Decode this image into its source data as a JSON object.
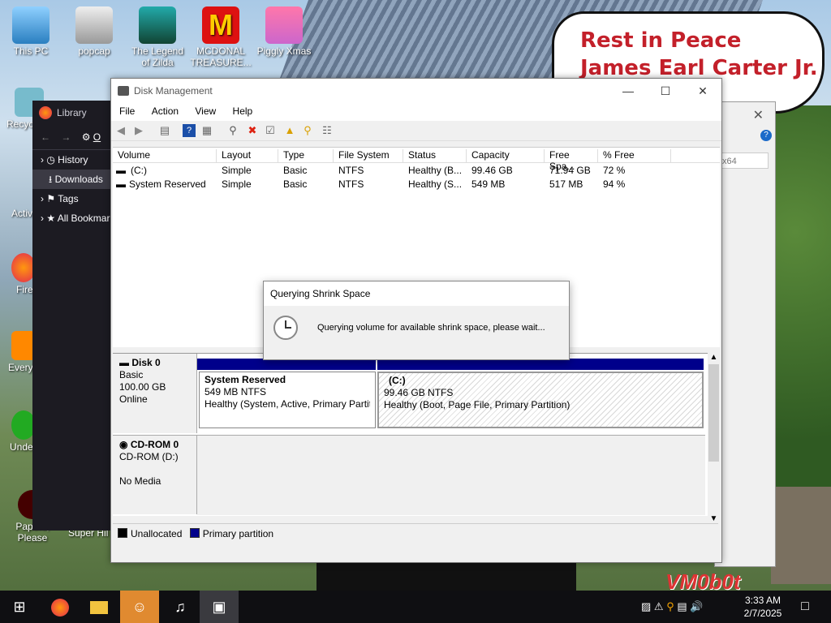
{
  "desktop": {
    "icons": [
      {
        "label": "This PC"
      },
      {
        "label": "popcap"
      },
      {
        "label": "The Legend of Zilda"
      },
      {
        "label": "MCDONAL TREASURE..."
      },
      {
        "label": "Piggly Xmas"
      },
      {
        "label": "Recyc"
      },
      {
        "label": "Activ"
      },
      {
        "label": "Fire"
      },
      {
        "label": "Every"
      },
      {
        "label": "Unde"
      },
      {
        "label": "Papers, Please"
      },
      {
        "label": "Super Hil"
      }
    ],
    "speech_line1": "Rest in Peace",
    "speech_line2": "James Earl Carter Jr.",
    "watermark": "VM0b0t"
  },
  "library": {
    "title": "Library",
    "items": [
      {
        "label": "History"
      },
      {
        "label": "Downloads"
      },
      {
        "label": "Tags"
      },
      {
        "label": "All Bookmarks"
      }
    ],
    "org_label": "O"
  },
  "bg_window": {
    "search_text": "x64"
  },
  "dm": {
    "title": "Disk Management",
    "menu": [
      "File",
      "Action",
      "View",
      "Help"
    ],
    "columns": [
      "Volume",
      "Layout",
      "Type",
      "File System",
      "Status",
      "Capacity",
      "Free Spa...",
      "% Free"
    ],
    "rows": [
      {
        "volume": "(C:)",
        "layout": "Simple",
        "type": "Basic",
        "fs": "NTFS",
        "status": "Healthy (B...",
        "capacity": "99.46 GB",
        "free": "71.94 GB",
        "pct": "72 %"
      },
      {
        "volume": "System Reserved",
        "layout": "Simple",
        "type": "Basic",
        "fs": "NTFS",
        "status": "Healthy (S...",
        "capacity": "549 MB",
        "free": "517 MB",
        "pct": "94 %"
      }
    ],
    "disk0": {
      "name": "Disk 0",
      "type": "Basic",
      "size": "100.00 GB",
      "state": "Online"
    },
    "parts": [
      {
        "name": "System Reserved",
        "size": "549 MB NTFS",
        "status": "Healthy (System, Active, Primary Partiti"
      },
      {
        "name": "(C:)",
        "size": "99.46 GB NTFS",
        "status": "Healthy (Boot, Page File, Primary Partition)"
      }
    ],
    "cdrom": {
      "name": "CD-ROM 0",
      "type": "CD-ROM (D:)",
      "state": "No Media"
    },
    "legend": [
      "Unallocated",
      "Primary partition"
    ],
    "colors": {
      "unallocated": "#000000",
      "primary": "#00008b"
    }
  },
  "dialog": {
    "title": "Querying Shrink Space",
    "message": "Querying volume for available shrink space, please wait..."
  },
  "taskbar": {
    "time": "3:33 AM",
    "date": "2/7/2025"
  }
}
